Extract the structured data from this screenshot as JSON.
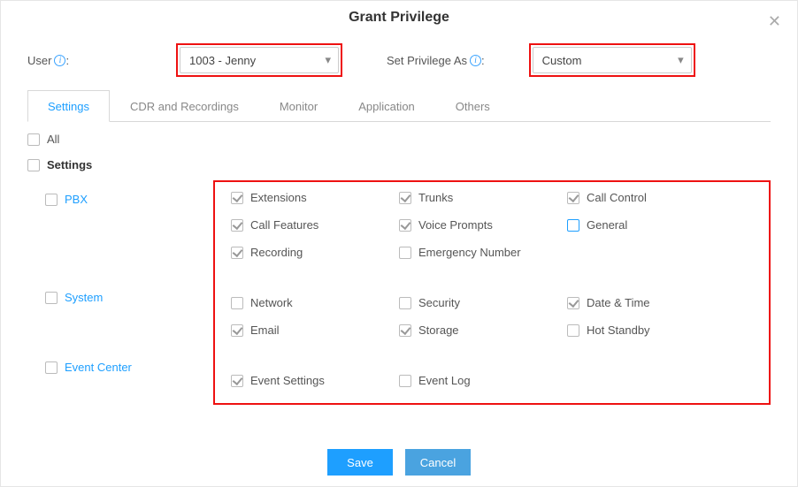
{
  "dialog": {
    "title": "Grant Privilege",
    "close_glyph": "✕"
  },
  "fields": {
    "user_label": "User",
    "user_value": "1003 - Jenny",
    "privilege_label": "Set Privilege As",
    "privilege_value": "Custom",
    "info_glyph": "i",
    "caret_glyph": "▾"
  },
  "tabs": {
    "settings": "Settings",
    "cdr": "CDR and Recordings",
    "monitor": "Monitor",
    "application": "Application",
    "others": "Others"
  },
  "tree": {
    "all": "All",
    "settings": "Settings",
    "pbx": "PBX",
    "system": "System",
    "event_center": "Event Center"
  },
  "privs": {
    "extensions": "Extensions",
    "trunks": "Trunks",
    "call_control": "Call Control",
    "call_features": "Call Features",
    "voice_prompts": "Voice Prompts",
    "general": "General",
    "recording": "Recording",
    "emergency_number": "Emergency Number",
    "network": "Network",
    "security": "Security",
    "date_time": "Date & Time",
    "email": "Email",
    "storage": "Storage",
    "hot_standby": "Hot Standby",
    "event_settings": "Event Settings",
    "event_log": "Event Log"
  },
  "buttons": {
    "save": "Save",
    "cancel": "Cancel"
  }
}
